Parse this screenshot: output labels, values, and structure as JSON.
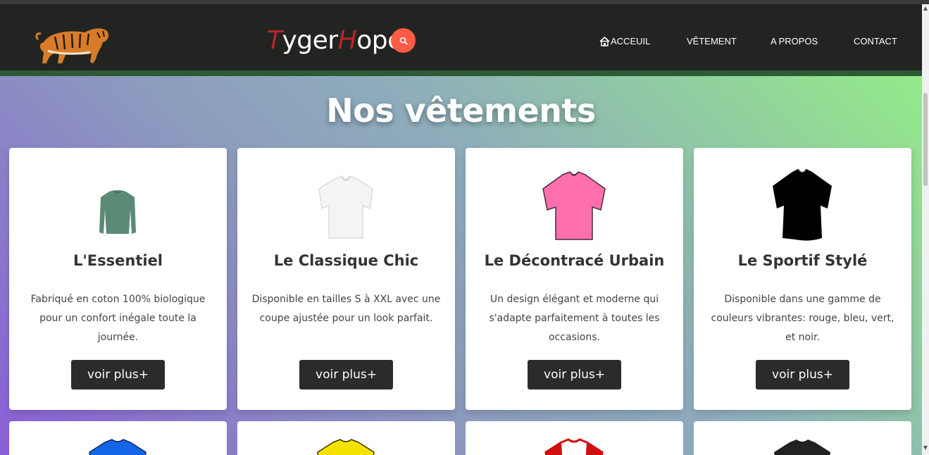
{
  "header": {
    "brand": {
      "part1": "T",
      "part2": "yger",
      "part3": "H",
      "part4": "ope"
    },
    "search_icon": "search-icon",
    "nav": [
      {
        "label": "ACCEUIL",
        "icon": "home-icon"
      },
      {
        "label": "VÊTEMENT"
      },
      {
        "label": "A PROPOS"
      },
      {
        "label": "CONTACT"
      }
    ]
  },
  "page": {
    "title": "Nos vêtements"
  },
  "products": [
    {
      "name": "L'Essentiel",
      "description": "Fabriqué en coton 100% biologique pour un confort inégale toute la journée.",
      "button": "voir plus+",
      "color": "#5b8a77"
    },
    {
      "name": "Le Classique Chic",
      "description": "Disponible en tailles S à XXL avec une coupe ajustée pour un look parfait.",
      "button": "voir plus+",
      "color": "#f4f4f4"
    },
    {
      "name": "Le Décontracé Urbain",
      "description": "Un design élégant et moderne qui s'adapte parfaitement à toutes les occasions.",
      "button": "voir plus+",
      "color": "#ff6fae"
    },
    {
      "name": "Le Sportif Stylé",
      "description": "Disponible dans une gamme de couleurs vibrantes: rouge, bleu, vert, et noir.",
      "button": "voir plus+",
      "color": "#000000"
    }
  ],
  "products_next_row": [
    {
      "color": "#1565e8"
    },
    {
      "color": "#f5e100"
    },
    {
      "color": "#d01010"
    },
    {
      "color": "#222222"
    }
  ],
  "colors": {
    "header_bg": "#222421",
    "search_accent": "#ff5b45",
    "brand_accent": "#b8242a",
    "button_bg": "#2b2b2b"
  }
}
